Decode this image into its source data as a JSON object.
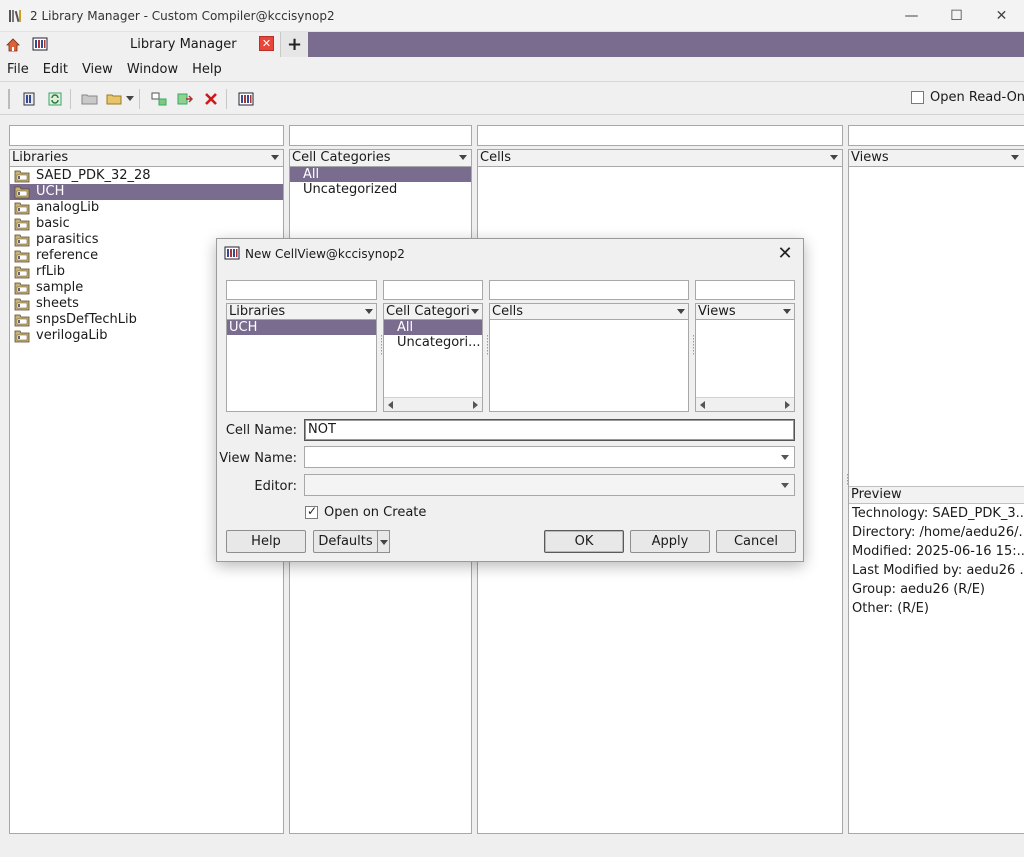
{
  "window": {
    "title": "2 Library Manager - Custom Compiler@kccisynop2",
    "minimize": "—",
    "maximize": "☐",
    "close": "✕"
  },
  "tabs": {
    "main_label": "Library Manager",
    "close_label": "✕",
    "add_label": "+"
  },
  "menu": [
    "File",
    "Edit",
    "View",
    "Window",
    "Help"
  ],
  "toolbar": {
    "open_readonly_label": "Open Read-Only",
    "open_readonly_checked": false
  },
  "library_manager": {
    "libraries_header": "Libraries",
    "categories_header": "Cell Categories",
    "cells_header": "Cells",
    "views_header": "Views",
    "libraries": [
      "SAED_PDK_32_28",
      "UCH",
      "analogLib",
      "basic",
      "parasitics",
      "reference",
      "rfLib",
      "sample",
      "sheets",
      "snpsDefTechLib",
      "verilogaLib"
    ],
    "selected_library": "UCH",
    "categories": [
      "All",
      "Uncategorized"
    ],
    "selected_category": "All"
  },
  "preview": {
    "header": "Preview",
    "lines": [
      "Technology: SAED_PDK_3...",
      "Directory: /home/aedu26/...",
      "Modified: 2025-06-16 15:...",
      "Last Modified by: aedu26 ...",
      "Group: aedu26 (R/E)",
      "Other: (R/E)"
    ]
  },
  "dialog": {
    "title": "New CellView@kccisynop2",
    "close": "✕",
    "libraries_header": "Libraries",
    "categories_header": "Cell Categories",
    "cells_header": "Cells",
    "views_header": "Views",
    "libraries": [
      "UCH"
    ],
    "categories": [
      "All",
      "Uncategori..."
    ],
    "cell_name_label": "Cell Name:",
    "cell_name_value": "NOT",
    "view_name_label": "View Name:",
    "view_name_value": "",
    "editor_label": "Editor:",
    "editor_value": "",
    "open_on_create_label": "Open on Create",
    "open_on_create_checked": true,
    "buttons": {
      "help": "Help",
      "defaults": "Defaults",
      "ok": "OK",
      "apply": "Apply",
      "cancel": "Cancel"
    }
  },
  "colors": {
    "accent": "#7a6c8f",
    "close_tab": "#e8463a"
  }
}
